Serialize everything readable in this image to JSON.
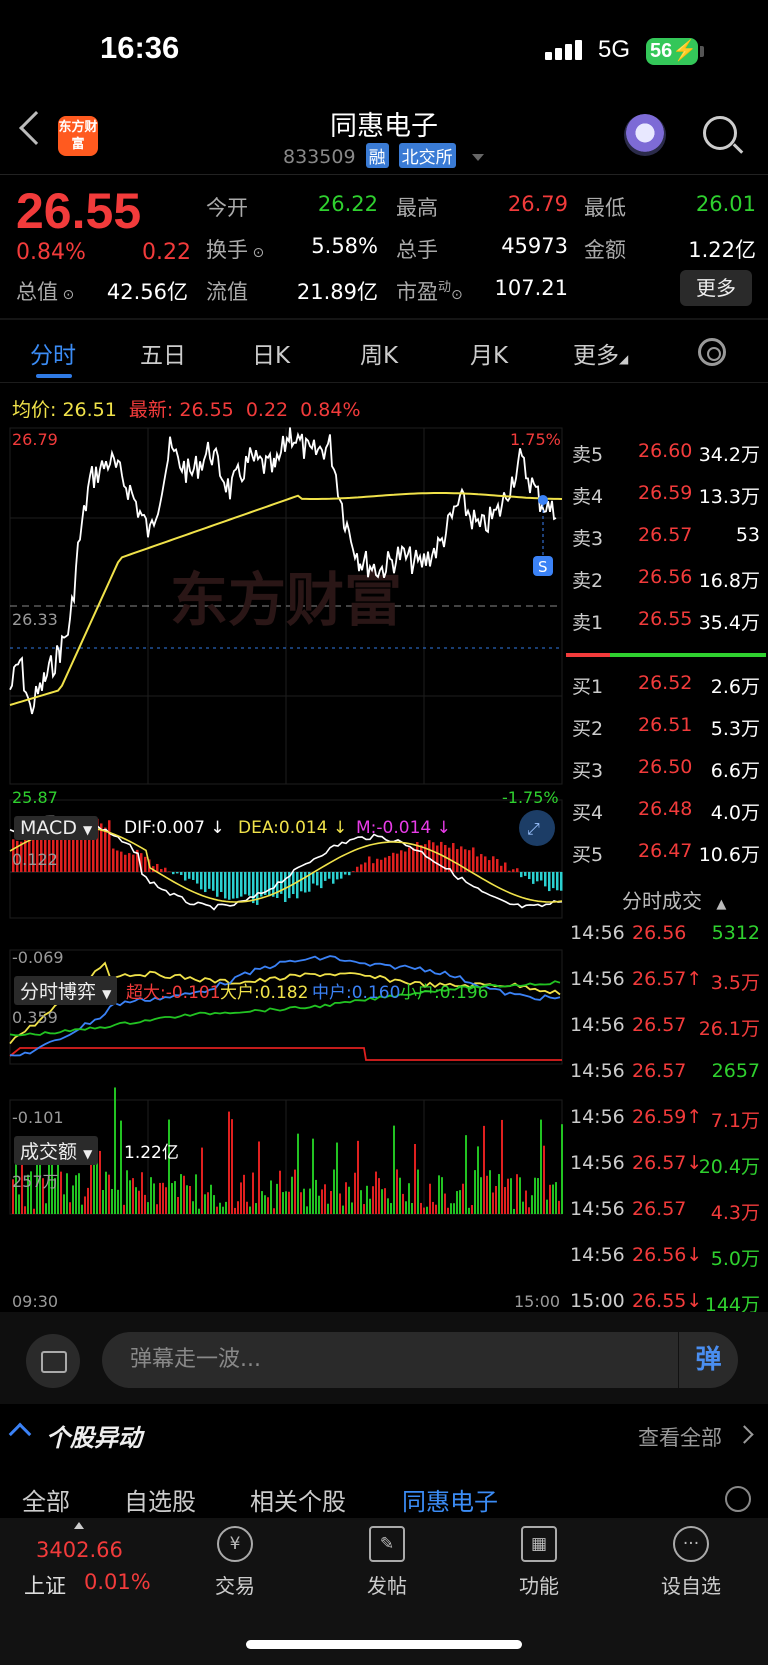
{
  "status": {
    "time": "16:36",
    "network": "5G",
    "battery": "56"
  },
  "header": {
    "logo": "东方财富",
    "name": "同惠电子",
    "code": "833509",
    "tag1": "融",
    "tag2": "北交所"
  },
  "quote": {
    "price": "26.55",
    "change_pct": "0.84%",
    "change": "0.22",
    "open_label": "今开",
    "open": "26.22",
    "high_label": "最高",
    "high": "26.79",
    "low_label": "最低",
    "low": "26.01",
    "turnover_label": "换手",
    "turnover": "5.58%",
    "volume_label": "总手",
    "volume": "45973",
    "amount_label": "金额",
    "amount": "1.22亿",
    "mcap_label": "总值",
    "mcap": "42.56亿",
    "float_label": "流值",
    "float": "21.89亿",
    "pe_label": "市盈",
    "pe_sup": "动",
    "pe": "107.21",
    "more_btn": "更多"
  },
  "tabs": [
    "分时",
    "五日",
    "日K",
    "周K",
    "月K",
    "更多"
  ],
  "chart_header": {
    "avg_label": "均价:",
    "avg": "26.51",
    "latest_label": "最新:",
    "latest": "26.55",
    "chg": "0.22",
    "pct": "0.84%"
  },
  "axis": {
    "top_price": "26.79",
    "mid_price": "26.33",
    "bottom_price": "25.87",
    "top_pct": "1.75%",
    "bottom_pct": "-1.75%",
    "start_time": "09:30",
    "end_time": "15:00",
    "marker": "S"
  },
  "macd": {
    "label": "MACD",
    "dif": "DIF:0.007 ↓",
    "dea": "DEA:0.014 ↓",
    "m": "M:-0.014 ↓",
    "top": "0.122",
    "bottom": "-0.069"
  },
  "fund_flow": {
    "label": "分时博弈",
    "super": "超大:-0.101",
    "large": "大户:0.182",
    "mid": "中户:0.160",
    "small": "小户:0.196",
    "top": "0.359",
    "bottom": "-0.101"
  },
  "volume_panel": {
    "label": "成交额",
    "total": "1.22亿",
    "top": "257万"
  },
  "colors": {
    "up": "#f23b3b",
    "down": "#2fd12f",
    "avg": "#f0e24a",
    "accent": "#2f7ae5"
  },
  "order_book": {
    "asks": [
      {
        "label": "卖5",
        "price": "26.60",
        "vol": "34.2万"
      },
      {
        "label": "卖4",
        "price": "26.59",
        "vol": "13.3万"
      },
      {
        "label": "卖3",
        "price": "26.57",
        "vol": "53"
      },
      {
        "label": "卖2",
        "price": "26.56",
        "vol": "16.8万"
      },
      {
        "label": "卖1",
        "price": "26.55",
        "vol": "35.4万"
      }
    ],
    "bids": [
      {
        "label": "买1",
        "price": "26.52",
        "vol": "2.6万"
      },
      {
        "label": "买2",
        "price": "26.51",
        "vol": "5.3万"
      },
      {
        "label": "买3",
        "price": "26.50",
        "vol": "6.6万"
      },
      {
        "label": "买4",
        "price": "26.48",
        "vol": "4.0万"
      },
      {
        "label": "买5",
        "price": "26.47",
        "vol": "10.6万"
      }
    ]
  },
  "trades": {
    "title": "分时成交",
    "rows": [
      {
        "time": "14:56",
        "price": "26.56",
        "vol": "5312",
        "pc": "red",
        "vc": "green"
      },
      {
        "time": "14:56",
        "price": "26.57↑",
        "vol": "3.5万",
        "pc": "red",
        "vc": "red"
      },
      {
        "time": "14:56",
        "price": "26.57",
        "vol": "26.1万",
        "pc": "red",
        "vc": "red"
      },
      {
        "time": "14:56",
        "price": "26.57",
        "vol": "2657",
        "pc": "red",
        "vc": "green"
      },
      {
        "time": "14:56",
        "price": "26.59↑",
        "vol": "7.1万",
        "pc": "red",
        "vc": "red"
      },
      {
        "time": "14:56",
        "price": "26.57↓",
        "vol": "20.4万",
        "pc": "red",
        "vc": "green"
      },
      {
        "time": "14:56",
        "price": "26.57",
        "vol": "4.3万",
        "pc": "red",
        "vc": "red"
      },
      {
        "time": "14:56",
        "price": "26.56↓",
        "vol": "5.0万",
        "pc": "red",
        "vc": "green"
      },
      {
        "time": "15:00",
        "price": "26.55↓",
        "vol": "144万",
        "pc": "red",
        "vc": "green"
      }
    ]
  },
  "danmu": {
    "placeholder": "弹幕走一波...",
    "send": "弹"
  },
  "news": {
    "title": "个股异动",
    "view_all": "查看全部",
    "tabs": [
      "全部",
      "自选股",
      "相关个股",
      "同惠电子"
    ]
  },
  "bottom_nav": {
    "index_value": "3402.66",
    "index_name": "上证",
    "index_pct": "0.01%",
    "items": [
      {
        "label": "交易",
        "icon": "yen-exchange-icon",
        "glyph": "¥"
      },
      {
        "label": "发帖",
        "icon": "edit-icon",
        "glyph": "✎"
      },
      {
        "label": "功能",
        "icon": "grid-icon",
        "glyph": "▦"
      },
      {
        "label": "设自选",
        "icon": "more-dots-icon",
        "glyph": "···"
      }
    ]
  }
}
